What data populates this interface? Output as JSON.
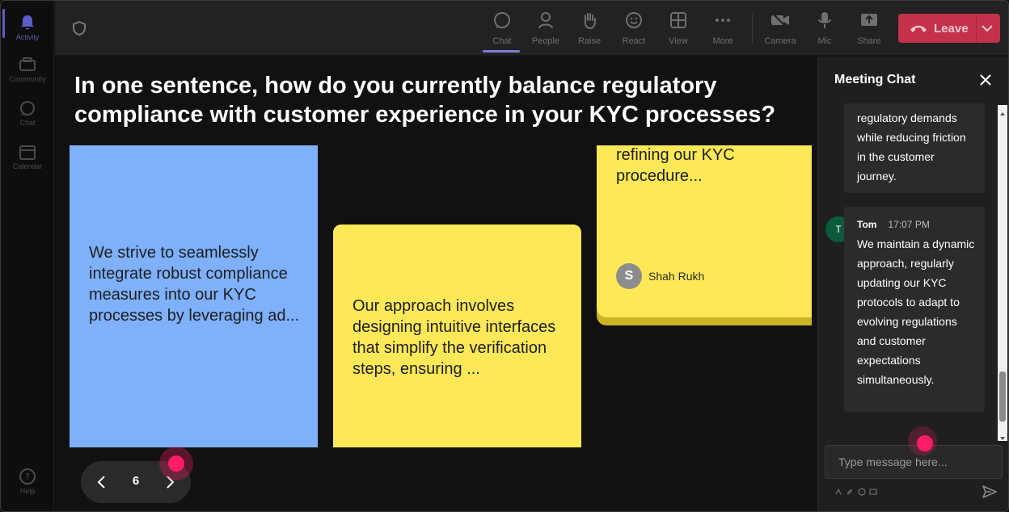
{
  "rail": {
    "items": [
      {
        "label": "Activity"
      },
      {
        "label": "Community"
      },
      {
        "label": "Chat"
      },
      {
        "label": "Calendar"
      },
      {
        "label": "Help"
      }
    ]
  },
  "toolbar": {
    "chat": "Chat",
    "people": "People",
    "raise": "Raise",
    "react": "React",
    "view": "View",
    "more": "More",
    "camera": "Camera",
    "mic": "Mic",
    "share": "Share",
    "leave": "Leave"
  },
  "stage": {
    "question": "In one sentence, how do you currently balance regulatory compliance with customer experience in your KYC processes?",
    "cards": [
      {
        "text": "We strive to seamlessly integrate robust compliance measures into our KYC processes by leveraging ad..."
      },
      {
        "text": "Our approach involves designing intuitive interfaces that simplify the verification steps, ensuring ..."
      },
      {
        "text": "refining our KYC procedure...",
        "author_initial": "S",
        "author": "Shah Rukh"
      }
    ],
    "pager": {
      "page": "6"
    }
  },
  "chat": {
    "title": "Meeting Chat",
    "messages": [
      {
        "text": "regulatory demands while reducing friction in the customer journey."
      },
      {
        "initial": "T",
        "name": "Tom",
        "time": "17:07 PM",
        "text": "We maintain a dynamic approach, regularly updating our KYC protocols to adapt to evolving regulations and customer expectations simultaneously."
      }
    ],
    "input_placeholder": "Type message here..."
  },
  "colors": {
    "accent": "#5b5fc7",
    "leave": "#c4314b",
    "card_blue": "#7eb0fc",
    "card_yellow": "#fde858",
    "cursor": "#ff1c6b"
  }
}
